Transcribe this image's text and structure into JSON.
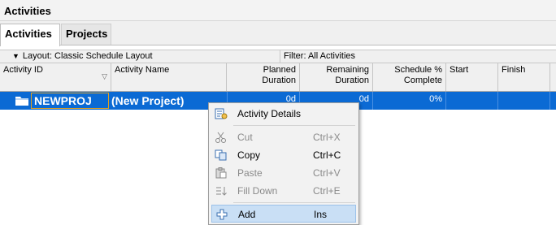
{
  "window": {
    "title": "Activities"
  },
  "tabs": [
    {
      "label": "Activities",
      "active": true
    },
    {
      "label": "Projects",
      "active": false
    }
  ],
  "toolbar": {
    "layout": "Layout: Classic Schedule Layout",
    "filter": "Filter: All Activities"
  },
  "columns": [
    {
      "label": "Activity ID"
    },
    {
      "label": "Activity Name"
    },
    {
      "label": "Planned Duration"
    },
    {
      "label": "Remaining Duration"
    },
    {
      "label": "Schedule % Complete"
    },
    {
      "label": "Start"
    },
    {
      "label": "Finish"
    }
  ],
  "rows": [
    {
      "activity_id": "NEWPROJ",
      "activity_name": "(New Project)",
      "planned_duration": "0d",
      "remaining_duration": "0d",
      "schedule_complete": "0%",
      "start": "",
      "finish": "",
      "selected": true
    }
  ],
  "context_menu": {
    "items": [
      {
        "label": "Activity Details",
        "shortcut": "",
        "enabled": true,
        "icon": "activity-details-icon"
      },
      {
        "label": "Cut",
        "shortcut": "Ctrl+X",
        "enabled": false,
        "icon": "scissors-icon"
      },
      {
        "label": "Copy",
        "shortcut": "Ctrl+C",
        "enabled": true,
        "icon": "copy-icon"
      },
      {
        "label": "Paste",
        "shortcut": "Ctrl+V",
        "enabled": false,
        "icon": "clipboard-icon"
      },
      {
        "label": "Fill Down",
        "shortcut": "Ctrl+E",
        "enabled": false,
        "icon": "fill-down-icon"
      },
      {
        "label": "Add",
        "shortcut": "Ins",
        "enabled": true,
        "highlighted": true,
        "icon": "plus-icon"
      }
    ]
  },
  "colors": {
    "selection": "#0b6ad4",
    "menu_highlight": "#c9dff5",
    "id_focus_border": "#e0a020"
  }
}
